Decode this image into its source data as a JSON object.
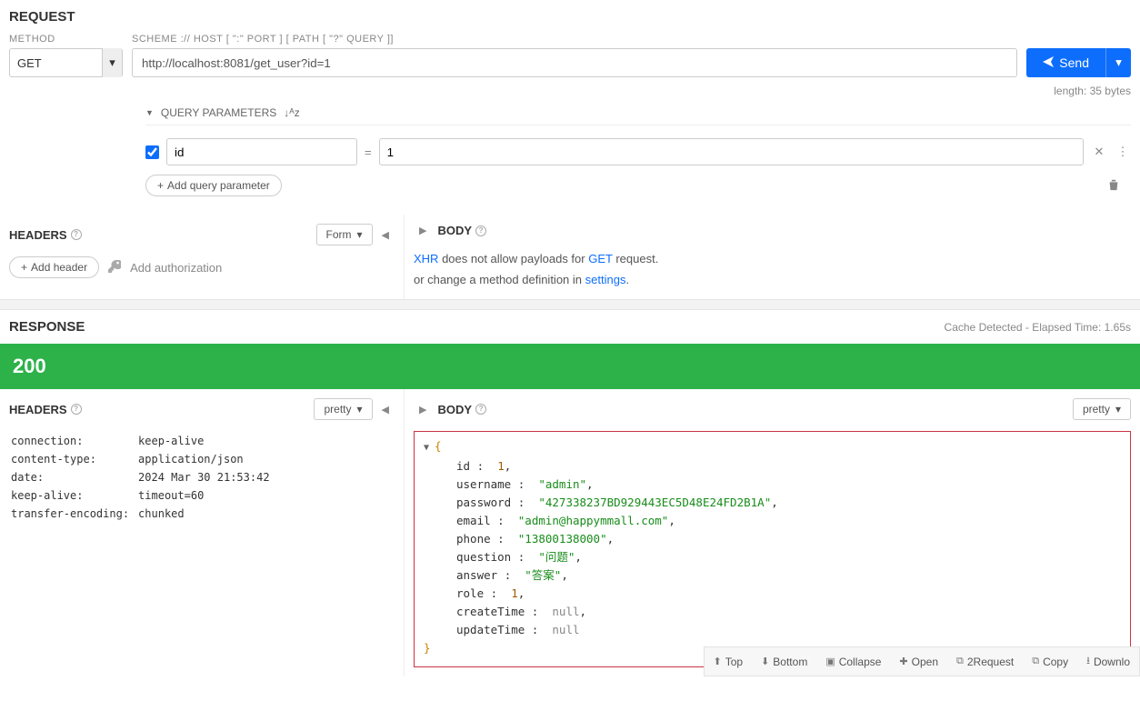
{
  "request": {
    "title": "REQUEST",
    "method_label": "METHOD",
    "method_value": "GET",
    "url_label": "SCHEME :// HOST [ \":\" PORT ] [ PATH [ \"?\" QUERY ]]",
    "url_value": "http://localhost:8081/get_user?id=1",
    "send_label": "Send",
    "length_text": "length: 35 bytes",
    "qp_title": "QUERY PARAMETERS",
    "qp_sort_glyph": "↓ᴬz",
    "params": [
      {
        "enabled": true,
        "key": "id",
        "value": "1"
      }
    ],
    "add_param_label": "Add query parameter",
    "headers_title": "HEADERS",
    "headers_mode": "Form",
    "add_header_label": "Add header",
    "add_auth_label": "Add authorization",
    "body_title": "BODY",
    "body_msg_xhr": "XHR",
    "body_msg_mid": " does not allow payloads for ",
    "body_msg_get": "GET",
    "body_msg_tail": " request.",
    "body_msg2_pre": "or change a method definition in ",
    "body_msg2_link": "settings",
    "body_msg2_tail": "."
  },
  "response": {
    "title": "RESPONSE",
    "meta": "Cache Detected - Elapsed Time: 1.65s",
    "status": "200",
    "headers_title": "HEADERS",
    "headers_mode": "pretty",
    "body_title": "BODY",
    "body_mode": "pretty",
    "headers": [
      {
        "k": "connection:",
        "v": "keep-alive"
      },
      {
        "k": "content-type:",
        "v": "application/json"
      },
      {
        "k": "date:",
        "v": "2024 Mar 30 21:53:42"
      },
      {
        "k": "keep-alive:",
        "v": "timeout=60"
      },
      {
        "k": "transfer-encoding:",
        "v": "chunked"
      }
    ],
    "json": {
      "id": {
        "label": "id",
        "val": "1",
        "type": "num"
      },
      "username": {
        "label": "username",
        "val": "\"admin\"",
        "type": "str"
      },
      "password": {
        "label": "password",
        "val": "\"427338237BD929443EC5D48E24FD2B1A\"",
        "type": "str"
      },
      "email": {
        "label": "email",
        "val": "\"admin@happymmall.com\"",
        "type": "str"
      },
      "phone": {
        "label": "phone",
        "val": "\"13800138000\"",
        "type": "str"
      },
      "question": {
        "label": "question",
        "val": "\"问题\"",
        "type": "str"
      },
      "answer": {
        "label": "answer",
        "val": "\"答案\"",
        "type": "str"
      },
      "role": {
        "label": "role",
        "val": "1",
        "type": "num"
      },
      "createTime": {
        "label": "createTime",
        "val": "null",
        "type": "null"
      },
      "updateTime": {
        "label": "updateTime",
        "val": "null",
        "type": "null"
      }
    },
    "toolbar": {
      "top": "Top",
      "bottom": "Bottom",
      "collapse": "Collapse",
      "open": "Open",
      "request": "2Request",
      "copy": "Copy",
      "download": "Downlo"
    }
  }
}
